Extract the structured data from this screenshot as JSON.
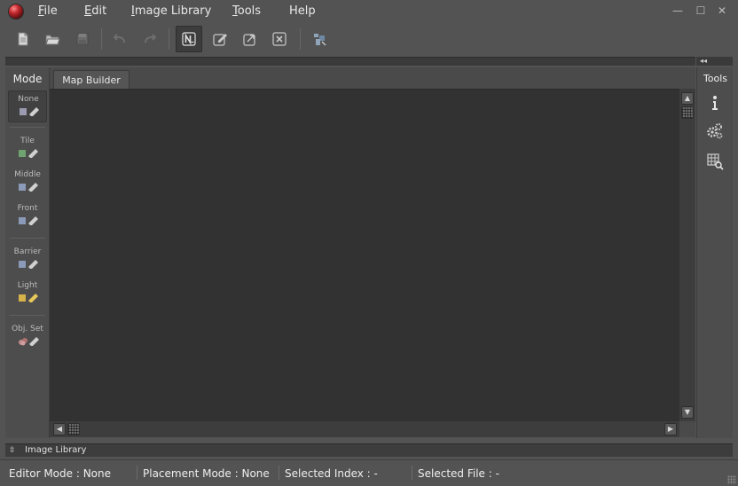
{
  "menubar": {
    "items": [
      {
        "label": "File",
        "mnemonic": "F",
        "rest": "ile"
      },
      {
        "label": "Edit",
        "mnemonic": "E",
        "rest": "dit"
      },
      {
        "label": "Image Library",
        "mnemonic": "I",
        "rest": "mage Library"
      },
      {
        "label": "Tools",
        "mnemonic": "T",
        "rest": "ools"
      },
      {
        "label": "Help",
        "mnemonic": "",
        "rest": "Help"
      }
    ],
    "window_controls": {
      "minimize": "—",
      "maximize": "☐",
      "close": "✕"
    }
  },
  "toolbar": {
    "icons": [
      "new-file-icon",
      "open-folder-icon",
      "save-icon",
      "undo-icon",
      "redo-icon",
      "new-map-icon",
      "edit-map-icon",
      "export-icon",
      "close-map-icon",
      "scripts-icon"
    ]
  },
  "header_strip": {
    "collapse_glyph": "◂◂"
  },
  "mode_panel": {
    "title": "Mode",
    "modes": [
      {
        "label": "None",
        "selected": true
      },
      {
        "label": "Tile",
        "selected": false
      },
      {
        "label": "Middle",
        "selected": false
      },
      {
        "label": "Front",
        "selected": false
      },
      {
        "label": "Barrier",
        "selected": false
      },
      {
        "label": "Light",
        "selected": false
      },
      {
        "label": "Obj. Set",
        "selected": false
      }
    ]
  },
  "tabs": [
    {
      "label": "Map Builder",
      "active": true
    }
  ],
  "tools_panel": {
    "title": "Tools",
    "tools": [
      "info-icon",
      "settings-gears-icon",
      "grid-search-icon"
    ]
  },
  "dock": {
    "toggle": "⇳",
    "title": "Image Library"
  },
  "status": {
    "editor_mode": "Editor Mode : None",
    "placement_mode": "Placement Mode : None",
    "selected_index": "Selected Index : -",
    "selected_file": "Selected File : -"
  },
  "colors": {
    "background": "#535353",
    "canvas": "#323232",
    "panel": "#4d4d4d",
    "accent_app_icon": "#c0262b"
  }
}
